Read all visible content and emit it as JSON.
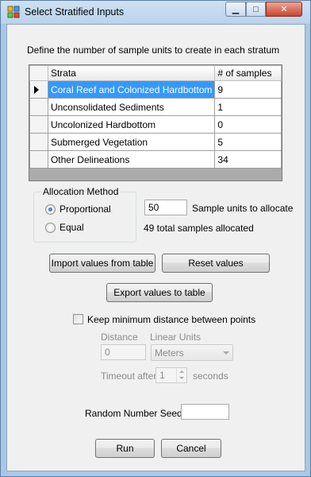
{
  "window": {
    "title": "Select Stratified Inputs",
    "close_glyph": "✕",
    "min_glyph": "▁",
    "max_glyph": "□"
  },
  "intro_text": "Define the number of sample units to create in each stratum",
  "grid": {
    "headers": {
      "strata": "Strata",
      "samples": "# of samples"
    },
    "rows": [
      {
        "strata": "Coral Reef and Colonized Hardbottom",
        "samples": "9"
      },
      {
        "strata": "Unconsolidated Sediments",
        "samples": "1"
      },
      {
        "strata": "Uncolonized Hardbottom",
        "samples": "0"
      },
      {
        "strata": "Submerged Vegetation",
        "samples": "5"
      },
      {
        "strata": "Other Delineations",
        "samples": "34"
      }
    ]
  },
  "allocation": {
    "legend": "Allocation Method",
    "proportional_label": "Proportional",
    "equal_label": "Equal",
    "sample_units_value": "50",
    "sample_units_label": "Sample units to allocate",
    "total_allocated": "49 total samples allocated"
  },
  "buttons": {
    "import": "Import values from table",
    "reset": "Reset values",
    "export": "Export values to table",
    "run": "Run",
    "cancel": "Cancel"
  },
  "distance": {
    "keep_min_label": "Keep minimum distance between points",
    "distance_label": "Distance",
    "distance_value": "0",
    "linear_units_label": "Linear Units",
    "linear_units_value": "Meters",
    "timeout_label": "Timeout after",
    "timeout_value": "1",
    "seconds_label": "seconds"
  },
  "seed": {
    "label": "Random Number Seed",
    "value": ""
  },
  "colors": {
    "selection": "#3399ff",
    "title_bar": "#b9d2ec",
    "client_bg": "#f0f0f0"
  }
}
